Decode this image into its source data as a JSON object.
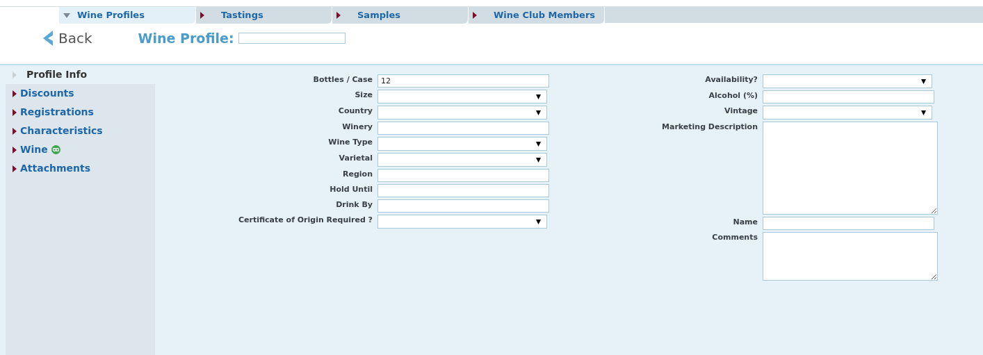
{
  "tabs": [
    {
      "label": "Wine Profiles",
      "selected": true
    },
    {
      "label": "Tastings",
      "selected": false
    },
    {
      "label": "Samples",
      "selected": false
    },
    {
      "label": "Wine Club Members",
      "selected": false
    }
  ],
  "header": {
    "back": "Back",
    "title": "Wine Profile:"
  },
  "sidebar": {
    "items": [
      {
        "label": "Profile Info",
        "selected": true,
        "badge": false
      },
      {
        "label": "Discounts",
        "selected": false,
        "badge": false
      },
      {
        "label": "Registrations",
        "selected": false,
        "badge": false
      },
      {
        "label": "Characteristics",
        "selected": false,
        "badge": false
      },
      {
        "label": "Wine",
        "selected": false,
        "badge": true
      },
      {
        "label": "Attachments",
        "selected": false,
        "badge": false
      }
    ]
  },
  "form": {
    "left": [
      {
        "label": "Bottles / Case",
        "kind": "text",
        "value": "12"
      },
      {
        "label": "Size",
        "kind": "select"
      },
      {
        "label": "Country",
        "kind": "select"
      },
      {
        "label": "Winery",
        "kind": "text"
      },
      {
        "label": "Wine Type",
        "kind": "select"
      },
      {
        "label": "Varietal",
        "kind": "select"
      },
      {
        "label": "Region",
        "kind": "text"
      },
      {
        "label": "Hold Until",
        "kind": "text"
      },
      {
        "label": "Drink By",
        "kind": "text"
      },
      {
        "label": "Certificate of Origin Required ?",
        "kind": "select"
      }
    ],
    "right": [
      {
        "label": "Availability?",
        "kind": "select"
      },
      {
        "label": "Alcohol (%)",
        "kind": "text"
      },
      {
        "label": "Vintage",
        "kind": "select"
      },
      {
        "label": "Marketing Description",
        "kind": "longtext"
      },
      {
        "label": "Name",
        "kind": "text"
      },
      {
        "label": "Comments",
        "kind": "textarea"
      }
    ]
  }
}
